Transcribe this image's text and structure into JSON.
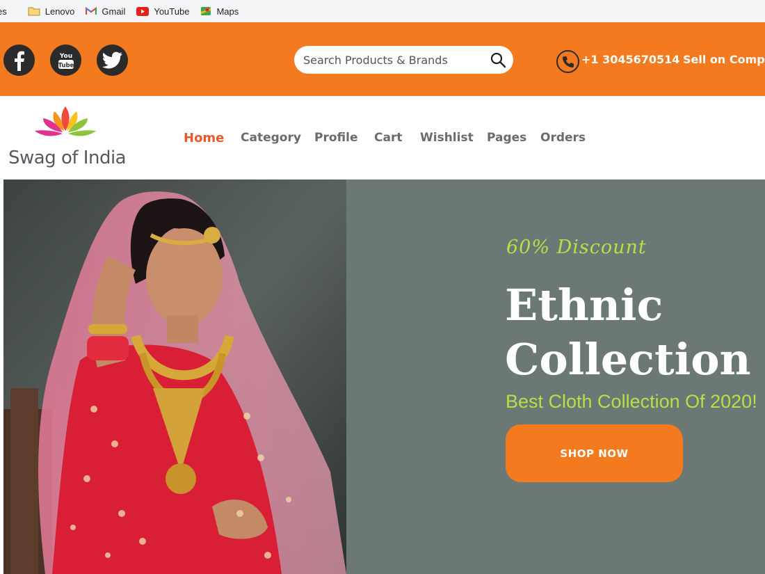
{
  "bookmarks": {
    "cut_label": "es",
    "items": [
      {
        "label": "Lenovo",
        "icon": "folder-icon"
      },
      {
        "label": "Gmail",
        "icon": "gmail-icon"
      },
      {
        "label": "YouTube",
        "icon": "youtube-icon"
      },
      {
        "label": "Maps",
        "icon": "maps-icon"
      }
    ]
  },
  "topbar": {
    "social": [
      "facebook-icon",
      "youtube-icon",
      "twitter-icon"
    ],
    "search_placeholder": "Search Products & Brands",
    "phone": "+1 3045670514",
    "sell": "Sell on Compa"
  },
  "logo": {
    "text": "Swag of India"
  },
  "nav": {
    "items": [
      "Home",
      "Category",
      "Profile",
      "Cart",
      "Wishlist",
      "Pages",
      "Orders"
    ],
    "active": "Home"
  },
  "hero": {
    "discount": "60% Discount",
    "headline_1": "Ethnic",
    "headline_2": "Collection",
    "subline": "Best Cloth Collection Of 2020!",
    "button": "SHOP NOW"
  },
  "colors": {
    "brand_orange": "#f47a1f",
    "active_nav": "#e8592a",
    "accent_green": "#b5e046",
    "hero_bg": "#6b7876"
  }
}
